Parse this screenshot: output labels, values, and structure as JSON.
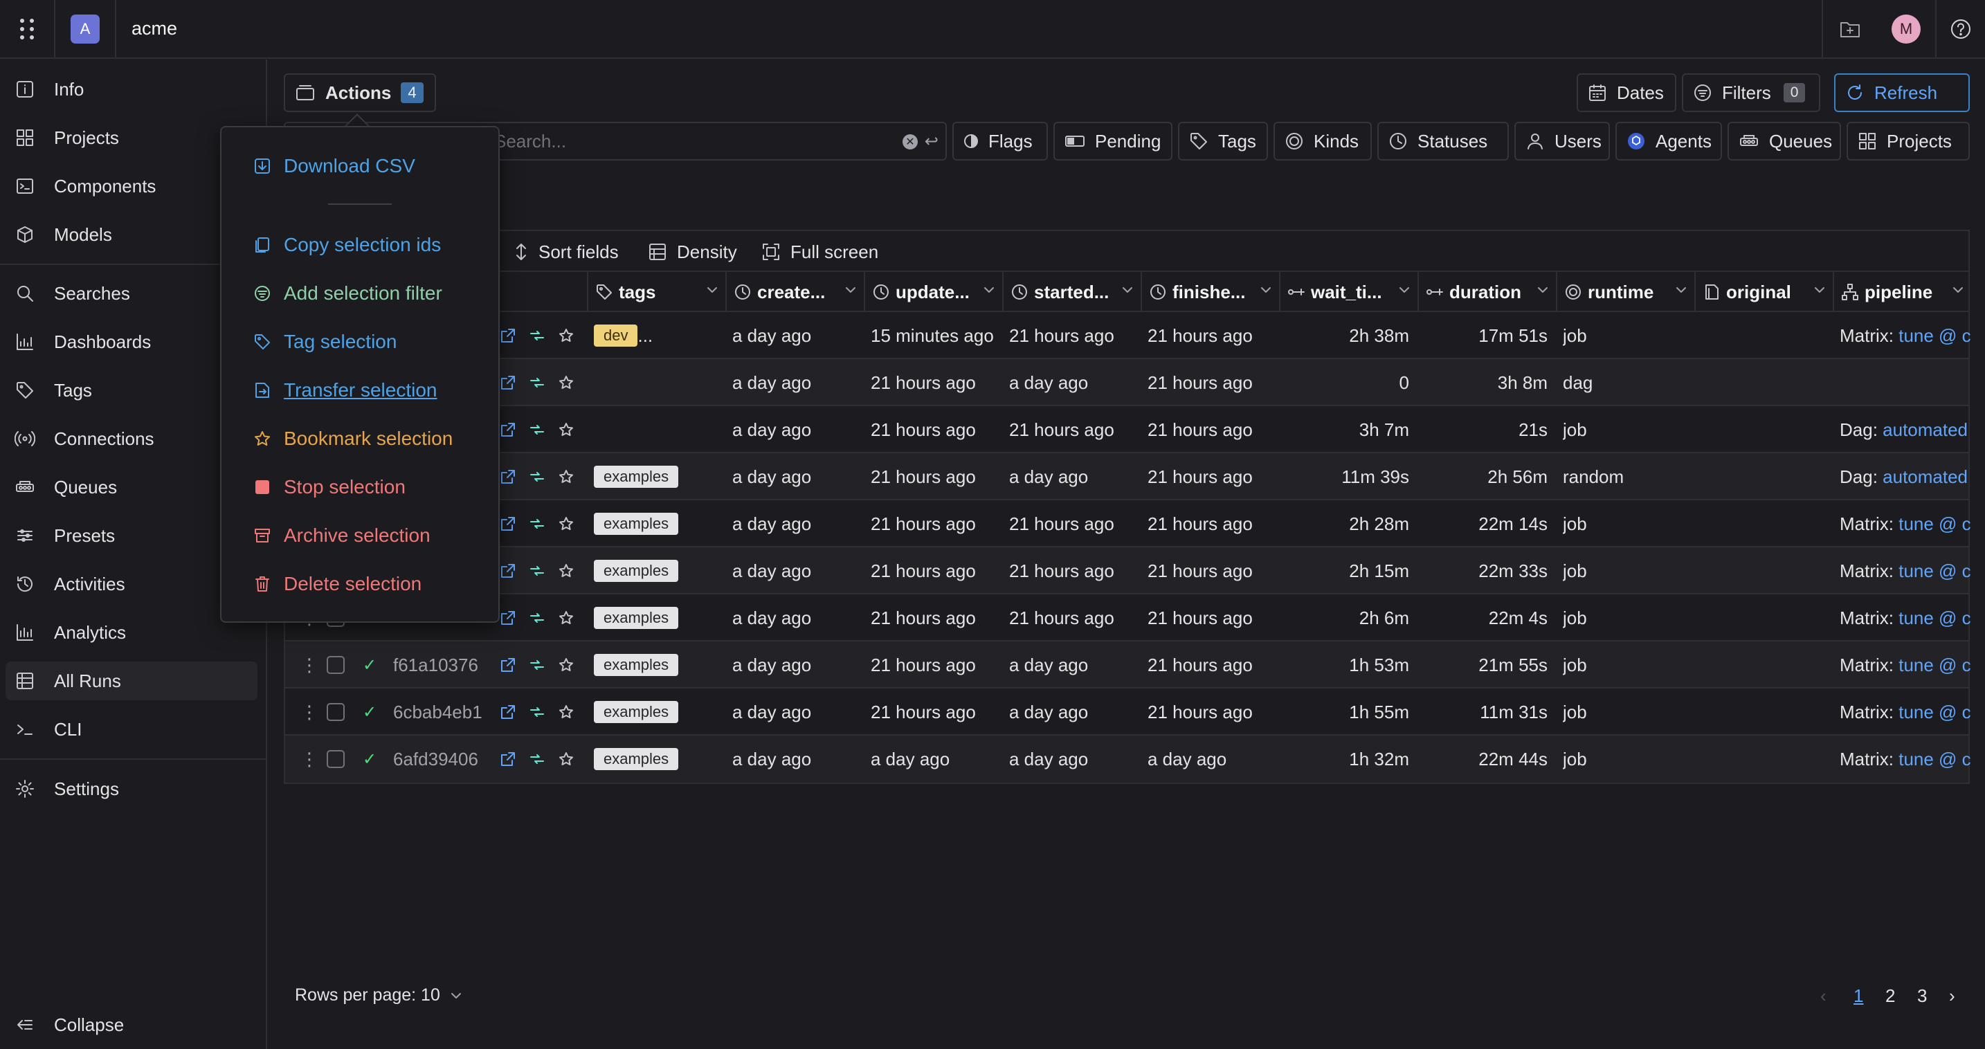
{
  "org": {
    "initial": "A",
    "name": "acme"
  },
  "user": {
    "initial": "M"
  },
  "sidebar": {
    "items": [
      {
        "label": "Info"
      },
      {
        "label": "Projects"
      },
      {
        "label": "Components"
      },
      {
        "label": "Models"
      },
      {
        "label": "Searches"
      },
      {
        "label": "Dashboards"
      },
      {
        "label": "Tags"
      },
      {
        "label": "Connections"
      },
      {
        "label": "Queues"
      },
      {
        "label": "Presets"
      },
      {
        "label": "Activities"
      },
      {
        "label": "Analytics"
      },
      {
        "label": "All Runs"
      },
      {
        "label": "CLI"
      },
      {
        "label": "Settings"
      }
    ],
    "collapse_label": "Collapse"
  },
  "header": {
    "actions_label": "Actions",
    "actions_count": "4",
    "dates_label": "Dates",
    "filters_label": "Filters",
    "filters_count": "0",
    "refresh_label": "Refresh"
  },
  "search": {
    "placeholder": "Search..."
  },
  "filters": {
    "flags": "Flags",
    "pending": "Pending",
    "tags": "Tags",
    "kinds": "Kinds",
    "statuses": "Statuses",
    "users": "Users",
    "agents": "Agents",
    "queues": "Queues",
    "projects": "Projects"
  },
  "toolbar": {
    "sort_fields": "Sort fields",
    "density": "Density",
    "full_screen": "Full screen"
  },
  "table": {
    "columns": [
      "tags",
      "create...",
      "update...",
      "started...",
      "finishe...",
      "wait_ti...",
      "duration",
      "runtime",
      "original",
      "pipeline"
    ],
    "rows": [
      {
        "id": "",
        "tag": "dev",
        "tag_extra": "...",
        "created": "a day ago",
        "updated": "15 minutes ago",
        "started": "21 hours ago",
        "finished": "21 hours ago",
        "wait": "2h 38m",
        "duration": "17m 51s",
        "runtime": "job",
        "pipeline_kind": "Matrix:",
        "pipeline_link": "tune @ c"
      },
      {
        "id": "",
        "tag": "",
        "tag_extra": "",
        "created": "a day ago",
        "updated": "21 hours ago",
        "started": "a day ago",
        "finished": "21 hours ago",
        "wait": "0",
        "duration": "3h 8m",
        "runtime": "dag",
        "pipeline_kind": "",
        "pipeline_link": ""
      },
      {
        "id": "",
        "tag": "",
        "tag_extra": "",
        "created": "a day ago",
        "updated": "21 hours ago",
        "started": "21 hours ago",
        "finished": "21 hours ago",
        "wait": "3h 7m",
        "duration": "21s",
        "runtime": "job",
        "pipeline_kind": "Dag:",
        "pipeline_link": "automated"
      },
      {
        "id": "",
        "tag": "examples",
        "tag_extra": "",
        "created": "a day ago",
        "updated": "21 hours ago",
        "started": "a day ago",
        "finished": "21 hours ago",
        "wait": "11m 39s",
        "duration": "2h 56m",
        "runtime": "random",
        "pipeline_kind": "Dag:",
        "pipeline_link": "automated"
      },
      {
        "id": "",
        "tag": "examples",
        "tag_extra": "",
        "created": "a day ago",
        "updated": "21 hours ago",
        "started": "21 hours ago",
        "finished": "21 hours ago",
        "wait": "2h 28m",
        "duration": "22m 14s",
        "runtime": "job",
        "pipeline_kind": "Matrix:",
        "pipeline_link": "tune @ c"
      },
      {
        "id": "",
        "tag": "examples",
        "tag_extra": "",
        "created": "a day ago",
        "updated": "21 hours ago",
        "started": "21 hours ago",
        "finished": "21 hours ago",
        "wait": "2h 15m",
        "duration": "22m 33s",
        "runtime": "job",
        "pipeline_kind": "Matrix:",
        "pipeline_link": "tune @ c"
      },
      {
        "id": "",
        "tag": "examples",
        "tag_extra": "",
        "created": "a day ago",
        "updated": "21 hours ago",
        "started": "21 hours ago",
        "finished": "21 hours ago",
        "wait": "2h 6m",
        "duration": "22m 4s",
        "runtime": "job",
        "pipeline_kind": "Matrix:",
        "pipeline_link": "tune @ c"
      },
      {
        "id": "f61a10376",
        "tag": "examples",
        "tag_extra": "",
        "created": "a day ago",
        "updated": "21 hours ago",
        "started": "a day ago",
        "finished": "21 hours ago",
        "wait": "1h 53m",
        "duration": "21m 55s",
        "runtime": "job",
        "pipeline_kind": "Matrix:",
        "pipeline_link": "tune @ c"
      },
      {
        "id": "6cbab4eb1",
        "tag": "examples",
        "tag_extra": "",
        "created": "a day ago",
        "updated": "21 hours ago",
        "started": "a day ago",
        "finished": "21 hours ago",
        "wait": "1h 55m",
        "duration": "11m 31s",
        "runtime": "job",
        "pipeline_kind": "Matrix:",
        "pipeline_link": "tune @ c"
      },
      {
        "id": "6afd39406",
        "tag": "examples",
        "tag_extra": "",
        "created": "a day ago",
        "updated": "a day ago",
        "started": "a day ago",
        "finished": "a day ago",
        "wait": "1h 32m",
        "duration": "22m 44s",
        "runtime": "job",
        "pipeline_kind": "Matrix:",
        "pipeline_link": "tune @ c"
      }
    ]
  },
  "footer": {
    "rows_per_page": "Rows per page: 10",
    "pages": [
      "1",
      "2",
      "3"
    ]
  },
  "menu": {
    "download_csv": "Download CSV",
    "copy_ids": "Copy selection ids",
    "add_filter": "Add selection filter",
    "tag": "Tag selection",
    "transfer": "Transfer selection",
    "bookmark": "Bookmark selection",
    "stop": "Stop selection",
    "archive": "Archive selection",
    "delete": "Delete selection"
  }
}
